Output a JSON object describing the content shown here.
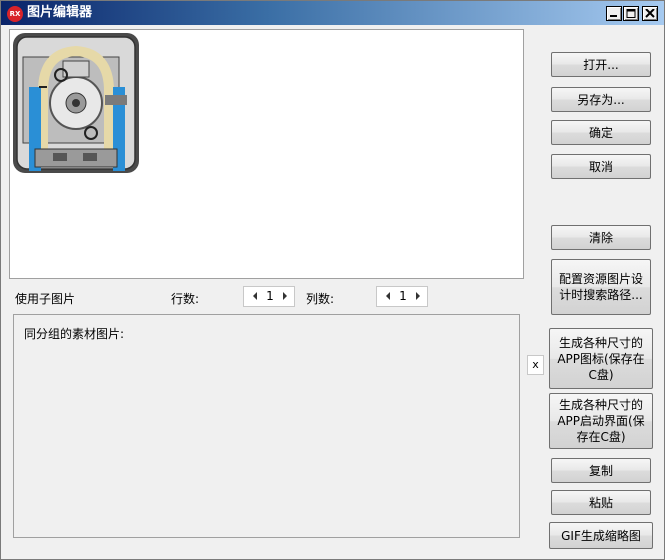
{
  "window": {
    "title": "图片编辑器",
    "icon_text": "RX"
  },
  "options": {
    "use_sub_image": "使用子图片",
    "rows_label": "行数:",
    "rows_value": "1",
    "cols_label": "列数:",
    "cols_value": "1"
  },
  "materials": {
    "title": "同分组的素材图片:"
  },
  "close_x": "x",
  "buttons": {
    "open": "打开...",
    "save_as": "另存为...",
    "ok": "确定",
    "cancel": "取消",
    "clear": "清除",
    "config_path": "配置资源图片设计时搜索路径...",
    "gen_icons": "生成各种尺寸的APP图标(保存在C盘)",
    "gen_splash": "生成各种尺寸的APP启动界面(保存在C盘)",
    "copy": "复制",
    "paste": "粘贴",
    "gif_thumb": "GIF生成缩略图"
  }
}
